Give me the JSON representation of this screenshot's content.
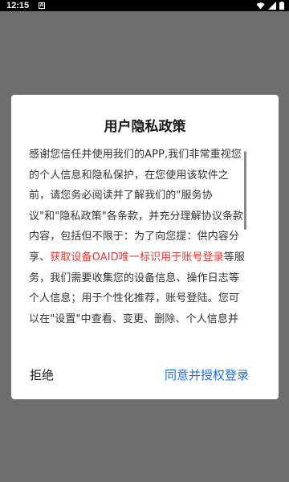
{
  "status_bar": {
    "time": "12:15",
    "notification_icon_letter": "A",
    "icons": [
      "wifi-icon",
      "signal-icon",
      "battery-icon"
    ]
  },
  "dialog": {
    "title": "用户隐私政策",
    "body_before_link": "感谢您信任并使用我们的APP,我们非常重视您的个人信息和隐私保护，在您使用该软件之前，请您务必阅读并了解我们的\"服务协议\"和\"隐私政策\"各条款，并充分理解协议条款内容，包括但不限于：为了向您提：供内容分享、",
    "body_link": "获取设备OAID唯一标识用于账号登录",
    "body_after_link": "等服务，我们需要收集您的设备信息、操作日志等个人信息；用于个性化推荐，账号登陆。您可以在\"设置\"中查看、变更、删除、个人信息并",
    "reject_label": "拒绝",
    "agree_label": "同意并授权登录"
  },
  "colors": {
    "link": "#e53935",
    "accent": "#1e6fdc",
    "overlay": "#6e6e6e"
  }
}
